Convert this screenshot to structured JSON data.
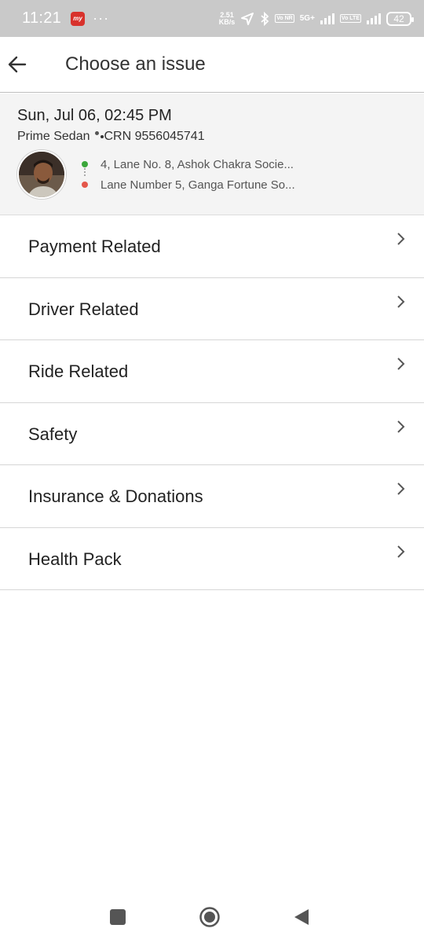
{
  "status": {
    "time": "11:21",
    "app_icon_text": "my",
    "overflow": "···",
    "speed_value": "2.51",
    "speed_unit": "KB/s",
    "net_tag_1": "Vo NR",
    "net_label": "5G+",
    "net_tag_2": "Vo LTE",
    "battery": "42"
  },
  "header": {
    "title": "Choose an issue"
  },
  "ride": {
    "datetime": "Sun, Jul 06, 02:45 PM",
    "car_type": "Prime Sedan",
    "crn": "CRN 9556045741",
    "pickup": "4, Lane No. 8, Ashok Chakra Socie...",
    "drop": "Lane Number 5, Ganga Fortune So..."
  },
  "issues": [
    {
      "label": "Payment Related"
    },
    {
      "label": "Driver Related"
    },
    {
      "label": "Ride Related"
    },
    {
      "label": "Safety"
    },
    {
      "label": "Insurance & Donations"
    },
    {
      "label": "Health Pack"
    }
  ],
  "icons": {
    "back": "arrow-left-icon",
    "chevron": "chevron-right-icon",
    "nav_recents": "square-icon",
    "nav_home": "circle-icon",
    "nav_back": "triangle-back-icon"
  },
  "colors": {
    "pickup_pin": "#3aa63a",
    "drop_pin": "#e4574b",
    "status_bar": "#c9c9c9",
    "card_bg": "#f4f4f4"
  }
}
